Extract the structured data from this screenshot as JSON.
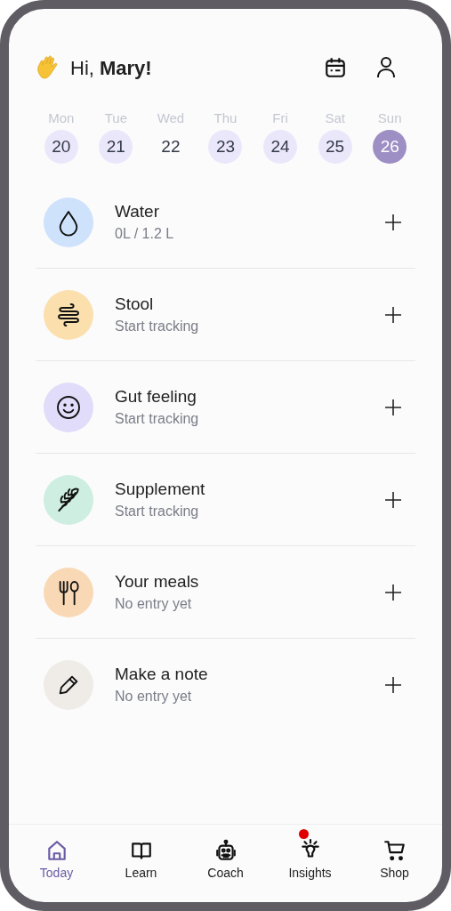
{
  "greeting": "Hi, **Mary!**",
  "days": [
    {
      "weekday": "Mon",
      "date": "20",
      "filled": true,
      "selected": false
    },
    {
      "weekday": "Tue",
      "date": "21",
      "filled": true,
      "selected": false
    },
    {
      "weekday": "Wed",
      "date": "22",
      "filled": false,
      "selected": false
    },
    {
      "weekday": "Thu",
      "date": "23",
      "filled": true,
      "selected": false
    },
    {
      "weekday": "Fri",
      "date": "24",
      "filled": true,
      "selected": false
    },
    {
      "weekday": "Sat",
      "date": "25",
      "filled": true,
      "selected": false
    },
    {
      "weekday": "Sun",
      "date": "26",
      "selected": true
    }
  ],
  "trackers": [
    {
      "kind": "water",
      "title": "Water",
      "subtitle": "0L / 1.2 L",
      "color": "#cfe2fb"
    },
    {
      "kind": "stool",
      "title": "Stool",
      "subtitle": "Start tracking",
      "color": "#fbe0ad"
    },
    {
      "kind": "feeling",
      "title": "Gut feeling",
      "subtitle": "Start tracking",
      "color": "#e0dcfa"
    },
    {
      "kind": "supplement",
      "title": "Supplement",
      "subtitle": "Start tracking",
      "color": "#cdeee0"
    },
    {
      "kind": "meals",
      "title": "Your meals",
      "subtitle": "No entry yet",
      "color": "#f9d9b5"
    },
    {
      "kind": "note",
      "title": "Make a note",
      "subtitle": "No entry yet",
      "color": "#efece8"
    }
  ],
  "nav": [
    {
      "kind": "home",
      "label": "Today",
      "selected": true,
      "badge": false
    },
    {
      "kind": "book",
      "label": "Learn",
      "selected": false,
      "badge": false
    },
    {
      "kind": "robot",
      "label": "Coach",
      "selected": false,
      "badge": false
    },
    {
      "kind": "bulb",
      "label": "Insights",
      "selected": false,
      "badge": true
    },
    {
      "kind": "cart",
      "label": "Shop",
      "selected": false,
      "badge": false
    }
  ]
}
